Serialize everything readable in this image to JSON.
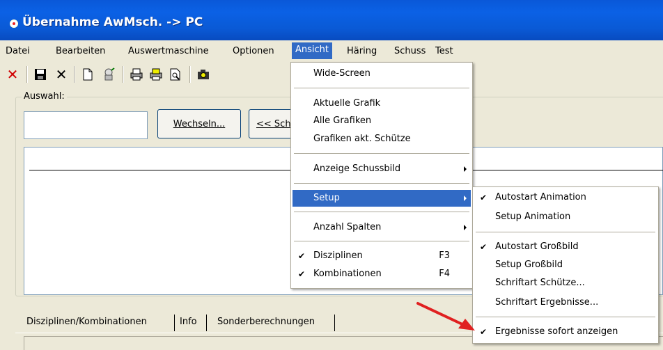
{
  "window": {
    "title": "Übernahme AwMsch. -> PC"
  },
  "menubar": [
    "Datei",
    "Bearbeiten",
    "Auswertmaschine",
    "Optionen",
    "Ansicht",
    "Häring",
    "Schuss",
    "Test"
  ],
  "selection_group": {
    "label": "Auswahl:",
    "input_value": "",
    "change_button": "Wechseln...",
    "back_button": "<< Sch"
  },
  "tabs": [
    "Disziplinen/Kombinationen",
    "Info",
    "Sonderberechnungen"
  ],
  "ansicht_menu": {
    "items": [
      {
        "label": "Wide-Screen"
      },
      {
        "label": "Aktuelle Grafik"
      },
      {
        "label": "Alle Grafiken"
      },
      {
        "label": "Grafiken akt. Schütze"
      },
      {
        "label": "Anzeige Schussbild",
        "submenu": true
      },
      {
        "label": "Setup",
        "submenu": true,
        "selected": true
      },
      {
        "label": "Anzahl Spalten",
        "submenu": true
      },
      {
        "label": "Disziplinen",
        "checked": true,
        "shortcut": "F3"
      },
      {
        "label": "Kombinationen",
        "checked": true,
        "shortcut": "F4"
      }
    ]
  },
  "setup_submenu": {
    "items": [
      {
        "label": "Autostart Animation",
        "checked": true
      },
      {
        "label": "Setup Animation"
      },
      {
        "label": "Autostart Großbild",
        "checked": true
      },
      {
        "label": "Setup Großbild"
      },
      {
        "label": "Schriftart Schütze..."
      },
      {
        "label": "Schriftart Ergebnisse..."
      },
      {
        "label": "Ergebnisse sofort anzeigen",
        "checked": true
      }
    ]
  },
  "icons": [
    "close-red-icon",
    "save-icon",
    "delete-icon",
    "new-doc-icon",
    "wizard-icon",
    "print-icon",
    "print-setup-icon",
    "print-preview-icon",
    "camera-icon"
  ],
  "colors": {
    "title_bar": "#0a58d8",
    "menu_highlight": "#316ac5",
    "annotation_arrow": "#e02020"
  }
}
